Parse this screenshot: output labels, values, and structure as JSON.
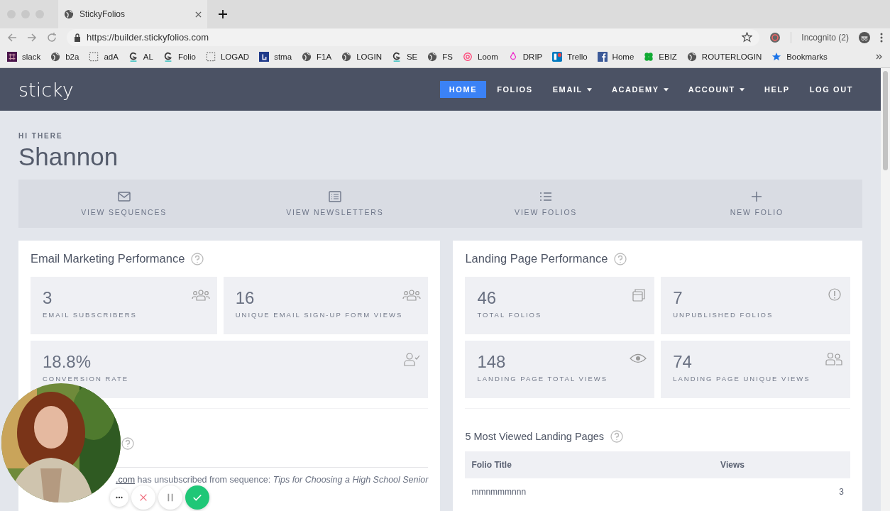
{
  "browser": {
    "tab_title": "StickyFolios",
    "url": "https://builder.stickyfolios.com",
    "profile": "Incognito (2)",
    "bookmarks": [
      {
        "label": "slack",
        "kind": "slack"
      },
      {
        "label": "b2a",
        "kind": "globe"
      },
      {
        "label": "adA",
        "kind": "dashed"
      },
      {
        "label": "AL",
        "kind": "folio"
      },
      {
        "label": "Folio",
        "kind": "folio"
      },
      {
        "label": "LOGAD",
        "kind": "dashed"
      },
      {
        "label": "stma",
        "kind": "square"
      },
      {
        "label": "F1A",
        "kind": "globe"
      },
      {
        "label": "LOGIN",
        "kind": "globe"
      },
      {
        "label": "SE",
        "kind": "folio"
      },
      {
        "label": "FS",
        "kind": "globe"
      },
      {
        "label": "Loom",
        "kind": "loom"
      },
      {
        "label": "DRIP",
        "kind": "drip"
      },
      {
        "label": "Trello",
        "kind": "trello"
      },
      {
        "label": "Home",
        "kind": "facebook"
      },
      {
        "label": "EBIZ",
        "kind": "clover"
      },
      {
        "label": "ROUTERLOGIN",
        "kind": "globe"
      },
      {
        "label": "Bookmarks",
        "kind": "star"
      }
    ]
  },
  "nav": {
    "brand": "sticky",
    "items": [
      {
        "label": "HOME",
        "selected": true,
        "dropdown": false
      },
      {
        "label": "FOLIOS",
        "selected": false,
        "dropdown": false
      },
      {
        "label": "EMAIL",
        "selected": false,
        "dropdown": true
      },
      {
        "label": "ACADEMY",
        "selected": false,
        "dropdown": true
      },
      {
        "label": "ACCOUNT",
        "selected": false,
        "dropdown": true
      },
      {
        "label": "HELP",
        "selected": false,
        "dropdown": false
      },
      {
        "label": "LOG OUT",
        "selected": false,
        "dropdown": false
      }
    ]
  },
  "greeting": {
    "label": "HI THERE",
    "name": "Shannon"
  },
  "quick_actions": [
    {
      "label": "VIEW SEQUENCES",
      "kind": "mail"
    },
    {
      "label": "VIEW NEWSLETTERS",
      "kind": "newsletter"
    },
    {
      "label": "VIEW FOLIOS",
      "kind": "list"
    },
    {
      "label": "NEW FOLIO",
      "kind": "plus"
    }
  ],
  "email_panel": {
    "title": "Email Marketing Performance",
    "stats": [
      {
        "value": "3",
        "label": "EMAIL SUBSCRIBERS",
        "kind": "group"
      },
      {
        "value": "16",
        "label": "UNIQUE EMAIL SIGN-UP FORM VIEWS",
        "kind": "group"
      },
      {
        "value": "18.8%",
        "label": "CONVERSION RATE",
        "kind": "user-check"
      }
    ],
    "activity": {
      "link": ".com",
      "message": "has unsubscribed from sequence:",
      "sequence": "Tips for Choosing a High School Senior"
    }
  },
  "landing_panel": {
    "title": "Landing Page Performance",
    "stats": [
      {
        "value": "46",
        "label": "TOTAL FOLIOS",
        "kind": "copies"
      },
      {
        "value": "7",
        "label": "UNPUBLISHED FOLIOS",
        "kind": "alert"
      },
      {
        "value": "148",
        "label": "LANDING PAGE TOTAL VIEWS",
        "kind": "eye"
      },
      {
        "value": "74",
        "label": "LANDING PAGE UNIQUE VIEWS",
        "kind": "pair"
      }
    ],
    "top_pages": {
      "title": "5 Most Viewed Landing Pages",
      "columns": [
        "Folio Title",
        "Views"
      ],
      "rows": [
        [
          "mmnmmmnnn",
          "3"
        ]
      ]
    }
  },
  "recorder": {
    "controls": [
      {
        "kind": "more"
      },
      {
        "kind": "cancel"
      },
      {
        "kind": "pause"
      },
      {
        "kind": "done"
      }
    ]
  }
}
